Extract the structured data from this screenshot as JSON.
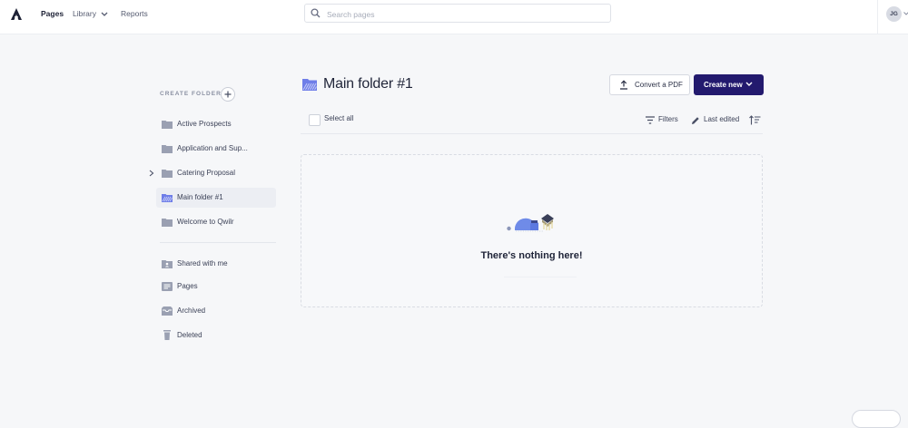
{
  "header": {
    "nav": [
      {
        "label": "Pages"
      },
      {
        "label": "Library"
      },
      {
        "label": "Reports"
      }
    ],
    "search": {
      "placeholder": "Search pages",
      "value": ""
    },
    "user_initials": "JG"
  },
  "sidebar": {
    "create_folder_label": "CREATE FOLDER",
    "folders": [
      {
        "label": "Active Prospects"
      },
      {
        "label": "Application and Sup..."
      },
      {
        "label": "Catering Proposal"
      },
      {
        "label": "Main folder #1"
      },
      {
        "label": "Welcome to Qwilr"
      }
    ],
    "sections": [
      {
        "label": "Shared with me",
        "icon": "shared-folder-icon"
      },
      {
        "label": "Pages",
        "icon": "pages-icon"
      },
      {
        "label": "Archived",
        "icon": "archive-icon"
      },
      {
        "label": "Deleted",
        "icon": "trash-icon"
      }
    ]
  },
  "main": {
    "title": "Main folder #1",
    "convert_pdf_label": "Convert a PDF",
    "create_new_label": "Create new",
    "select_all_label": "Select all",
    "filters_label": "Filters",
    "sort_label": "Last edited",
    "empty_message": "There's nothing here!"
  },
  "colors": {
    "primary": "#231a6e",
    "background": "#f6f7f9",
    "folder_icon": "#9aa0b2",
    "selected_folder_icon": "#6f7ee8"
  }
}
